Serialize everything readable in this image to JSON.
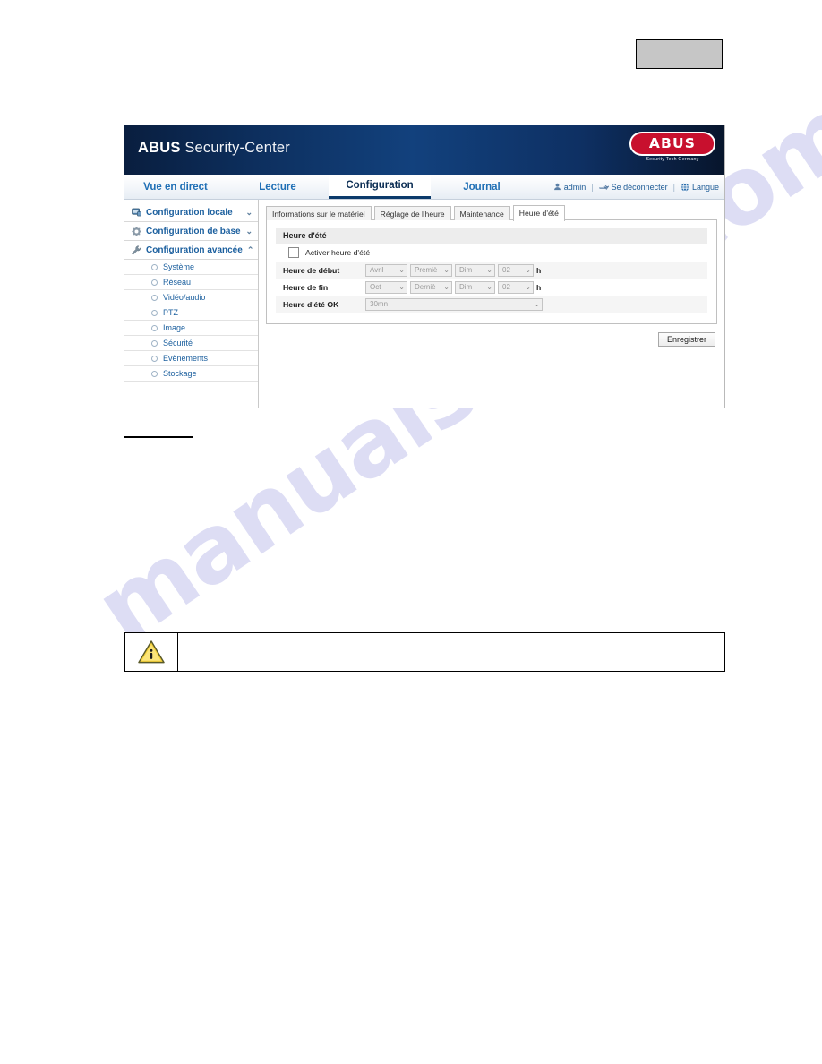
{
  "page": {
    "top_box_label": "",
    "note": {
      "icon": "warning-triangle-icon",
      "text": ""
    }
  },
  "app": {
    "brand_bold": "ABUS",
    "brand_light": " Security-Center",
    "logo": {
      "wordmark": "ABUS",
      "tagline": "Security Tech Germany",
      "color": "#c8102e"
    },
    "nav": {
      "tabs": [
        {
          "label": "Vue en direct",
          "active": false
        },
        {
          "label": "Lecture",
          "active": false
        },
        {
          "label": "Configuration",
          "active": true
        },
        {
          "label": "Journal",
          "active": false
        }
      ],
      "user": "admin",
      "logout": "Se déconnecter",
      "language": "Langue",
      "separator": "|"
    },
    "sidebar": {
      "groups": [
        {
          "label": "Configuration locale",
          "icon": "monitor-icon",
          "chevron": "⌄",
          "expanded": false
        },
        {
          "label": "Configuration de base",
          "icon": "gear-icon",
          "chevron": "⌄",
          "expanded": false
        },
        {
          "label": "Configuration avancée",
          "icon": "wrench-icon",
          "chevron": "⌃",
          "expanded": true
        }
      ],
      "items": [
        {
          "label": "Système"
        },
        {
          "label": "Réseau"
        },
        {
          "label": "Vidéo/audio"
        },
        {
          "label": "PTZ"
        },
        {
          "label": "Image"
        },
        {
          "label": "Sécurité"
        },
        {
          "label": "Evènements"
        },
        {
          "label": "Stockage"
        }
      ]
    },
    "content": {
      "tabs": [
        {
          "label": "Informations sur le matériel",
          "active": false
        },
        {
          "label": "Réglage de l'heure",
          "active": false
        },
        {
          "label": "Maintenance",
          "active": false
        },
        {
          "label": "Heure d'été",
          "active": true
        }
      ],
      "section_title": "Heure d'été",
      "enable_checkbox_label": "Activer heure d'été",
      "enable_checked": false,
      "rows": {
        "start": {
          "label": "Heure de début",
          "month": "Avril",
          "week": "Premiè",
          "day": "Dim",
          "hour": "02",
          "unit": "h"
        },
        "end": {
          "label": "Heure de fin",
          "month": "Oct",
          "week": "Derniè",
          "day": "Dim",
          "hour": "02",
          "unit": "h"
        },
        "offset": {
          "label": "Heure d'été OK",
          "value": "30mn"
        }
      },
      "save_label": "Enregistrer",
      "caret": "⌄"
    }
  },
  "watermark": {
    "text": "manualshive.com",
    "color": "#c9c9ee"
  }
}
